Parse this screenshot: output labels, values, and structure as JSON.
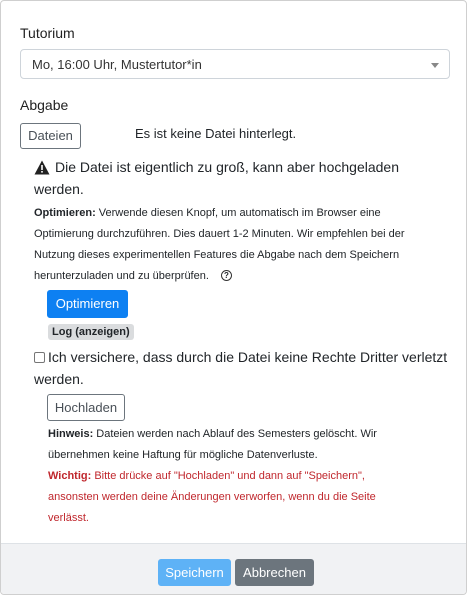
{
  "tutorium": {
    "label": "Tutorium",
    "selected": "Mo, 16:00 Uhr, Mustertutor*in"
  },
  "abgabe": {
    "label": "Abgabe",
    "files_button": "Dateien",
    "no_file_text": "Es ist keine Datei hinterlegt."
  },
  "warning": {
    "icon": "warning-triangle-icon",
    "line1": "Die Datei ist eigentlich zu groß, kann aber hochgeladen",
    "line2": "werden."
  },
  "optimize_info": {
    "label": "Optimieren:",
    "line1": "Verwende diesen Knopf, um automatisch im Browser eine",
    "line2": "Optimierung durchzuführen. Dies dauert 1-2 Minuten. Wir empfehlen bei der",
    "line3": "Nutzung dieses experimentellen Features die Abgabe nach dem Speichern",
    "line4": "herunterzuladen und zu überprüfen.",
    "help_icon": "question-circle-icon",
    "help_glyph": "?"
  },
  "optimize_button": "Optimieren",
  "log_badge": "Log (anzeigen)",
  "confirm": {
    "checked": false,
    "line1": "Ich versichere, dass durch die Datei keine Rechte Dritter verletzt",
    "line2": "werden."
  },
  "upload_button": "Hochladen",
  "hint": {
    "label": "Hinweis:",
    "line1": "Dateien werden nach Ablauf des Semesters gelöscht. Wir",
    "line2": "übernehmen keine Haftung für mögliche Datenverluste."
  },
  "important": {
    "label": "Wichtig:",
    "line1": "Bitte drücke auf \"Hochladen\" und dann auf \"Speichern\",",
    "line2": "ansonsten werden deine Änderungen verworfen, wenn du die Seite",
    "line3": "verlässt."
  },
  "footer": {
    "save": "Speichern",
    "cancel": "Abbrechen"
  },
  "colors": {
    "primary": "#0d80f2",
    "primary_disabled": "#5eb2f6",
    "secondary": "#6c757d",
    "danger_text": "#c0272d",
    "footer_bg": "#f1f2f4"
  }
}
